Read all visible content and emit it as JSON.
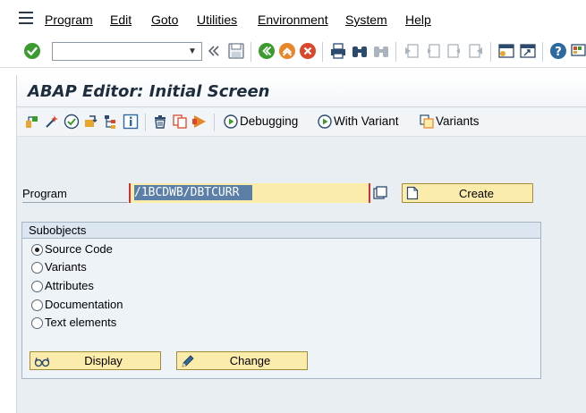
{
  "menu": {
    "items": [
      "Program",
      "Edit",
      "Goto",
      "Utilities",
      "Environment",
      "System",
      "Help"
    ]
  },
  "toolbar": {
    "command_field_value": "",
    "icons": [
      "enter-icon",
      "back-skip-icon",
      "save-icon",
      "back-icon",
      "exit-icon",
      "cancel-icon",
      "print-icon",
      "find-icon",
      "find-next-icon",
      "first-page-icon",
      "previous-page-icon",
      "next-page-icon",
      "last-page-icon",
      "create-session-icon",
      "shortcut-icon",
      "help-icon",
      "customize-layout-icon"
    ]
  },
  "screen": {
    "title": "ABAP Editor: Initial Screen"
  },
  "app_toolbar": {
    "debugging_label": "Debugging",
    "with_variant_label": "With Variant",
    "variants_label": "Variants"
  },
  "program": {
    "label": "Program",
    "value": "/1BCDWB/DBTCURR",
    "create_label": "Create"
  },
  "subobjects": {
    "title": "Subobjects",
    "options": [
      {
        "label": "Source Code",
        "checked": true
      },
      {
        "label": "Variants",
        "checked": false
      },
      {
        "label": "Attributes",
        "checked": false
      },
      {
        "label": "Documentation",
        "checked": false
      },
      {
        "label": "Text elements",
        "checked": false
      }
    ],
    "display_label": "Display",
    "change_label": "Change"
  },
  "colors": {
    "input_bg": "#fcecab",
    "panel_bg": "#e9eef3",
    "accent_green": "#3c9b2e",
    "accent_orange": "#e8862a",
    "accent_red": "#d9482b"
  }
}
